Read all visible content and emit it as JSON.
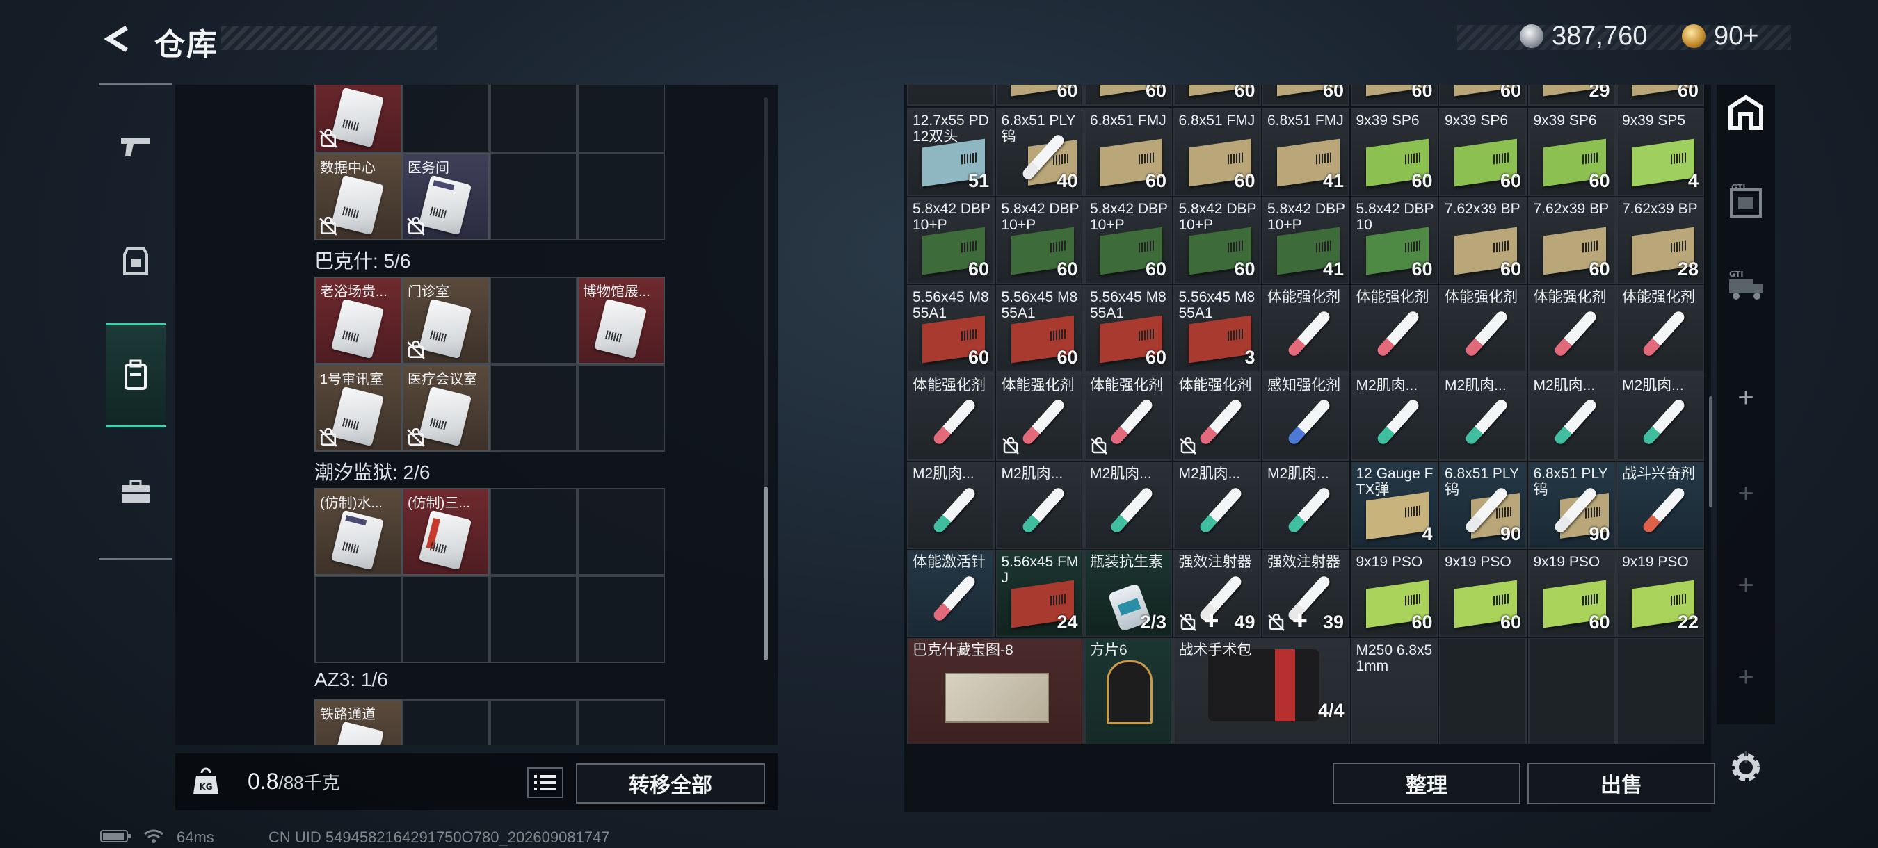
{
  "header": {
    "title": "仓库"
  },
  "currency": {
    "silver": "387,760",
    "gold": "90+"
  },
  "left_panel": {
    "sections": [
      {
        "name": "",
        "items": [
          {
            "label": "",
            "color": "red",
            "locked": true,
            "col": 0,
            "row": 0,
            "card": "plain"
          },
          {
            "label": "数据中心",
            "color": "brown",
            "locked": true,
            "col": 0,
            "row": 1,
            "card": "plain"
          },
          {
            "label": "医务间",
            "color": "purple",
            "locked": true,
            "col": 1,
            "row": 1,
            "card": "dark"
          }
        ]
      },
      {
        "name": "巴克什: 5/6",
        "items": [
          {
            "label": "老浴场贵...",
            "color": "red",
            "locked": false,
            "col": 0,
            "row": 0,
            "card": "plain"
          },
          {
            "label": "门诊室",
            "color": "brown",
            "locked": true,
            "col": 1,
            "row": 0,
            "card": "plain"
          },
          {
            "label": "博物馆展...",
            "color": "red",
            "locked": false,
            "col": 3,
            "row": 0,
            "card": "plain"
          },
          {
            "label": "1号审讯室",
            "color": "brown",
            "locked": true,
            "col": 0,
            "row": 1,
            "card": "plain"
          },
          {
            "label": "医疗会议室",
            "color": "brown",
            "locked": true,
            "col": 1,
            "row": 1,
            "card": "plain"
          }
        ]
      },
      {
        "name": "潮汐监狱: 2/6",
        "items": [
          {
            "label": "(仿制)水...",
            "color": "brown",
            "locked": false,
            "col": 0,
            "row": 0,
            "card": "dark"
          },
          {
            "label": "(仿制)三...",
            "color": "red",
            "locked": false,
            "col": 1,
            "row": 0,
            "card": "redstripe"
          }
        ]
      },
      {
        "name": "AZ3: 1/6",
        "items": [
          {
            "label": "铁路通道",
            "color": "brown",
            "locked": false,
            "col": 0,
            "row": 0,
            "card": "plain"
          }
        ]
      }
    ],
    "weight": {
      "current": "0.8",
      "max": "/88千克"
    },
    "transfer_all_label": "转移全部"
  },
  "inventory": {
    "top_row_counts": [
      "60",
      "60",
      "60",
      "60",
      "60",
      "60",
      "29",
      "60"
    ],
    "rows": [
      [
        {
          "label": "12.7x55 PD12双头",
          "count": "51",
          "kind": "ammo",
          "color": "#8fb7c2",
          "tone": "t-dark"
        },
        {
          "label": "6.8x51 PLY钨",
          "count": "40",
          "kind": "syringe-ammo",
          "color": "#e8eaec",
          "tone": "t-dark"
        },
        {
          "label": "6.8x51 FMJ",
          "count": "60",
          "kind": "ammo",
          "color": "#b9a77a",
          "tone": "t-dark"
        },
        {
          "label": "6.8x51 FMJ",
          "count": "60",
          "kind": "ammo",
          "color": "#b9a77a",
          "tone": "t-dark"
        },
        {
          "label": "6.8x51 FMJ",
          "count": "41",
          "kind": "ammo",
          "color": "#b9a77a",
          "tone": "t-dark"
        },
        {
          "label": "9x39 SP6",
          "count": "60",
          "kind": "ammo",
          "color": "#8cc152",
          "tone": "t-dark"
        },
        {
          "label": "9x39 SP6",
          "count": "60",
          "kind": "ammo",
          "color": "#8cc152",
          "tone": "t-dark"
        },
        {
          "label": "9x39 SP6",
          "count": "60",
          "kind": "ammo",
          "color": "#8cc152",
          "tone": "t-dark"
        },
        {
          "label": "9x39 SP5",
          "count": "4",
          "kind": "ammo",
          "color": "#9fcf5e",
          "tone": "t-dark"
        }
      ],
      [
        {
          "label": "5.8x42 DBP10+P",
          "count": "60",
          "kind": "ammo",
          "color": "#3d6b3a",
          "tone": "t-dark"
        },
        {
          "label": "5.8x42 DBP10+P",
          "count": "60",
          "kind": "ammo",
          "color": "#3d6b3a",
          "tone": "t-dark"
        },
        {
          "label": "5.8x42 DBP10+P",
          "count": "60",
          "kind": "ammo",
          "color": "#3d6b3a",
          "tone": "t-dark"
        },
        {
          "label": "5.8x42 DBP10+P",
          "count": "60",
          "kind": "ammo",
          "color": "#3d6b3a",
          "tone": "t-dark"
        },
        {
          "label": "5.8x42 DBP10+P",
          "count": "41",
          "kind": "ammo",
          "color": "#3d6b3a",
          "tone": "t-dark"
        },
        {
          "label": "5.8x42 DBP10",
          "count": "60",
          "kind": "ammo",
          "color": "#4f8a45",
          "tone": "t-dark"
        },
        {
          "label": "7.62x39 BP",
          "count": "60",
          "kind": "ammo",
          "color": "#b9a77a",
          "tone": "t-dark"
        },
        {
          "label": "7.62x39 BP",
          "count": "60",
          "kind": "ammo",
          "color": "#b9a77a",
          "tone": "t-dark"
        },
        {
          "label": "7.62x39 BP",
          "count": "28",
          "kind": "ammo",
          "color": "#b9a77a",
          "tone": "t-dark"
        }
      ],
      [
        {
          "label": "5.56x45 M855A1",
          "count": "60",
          "kind": "ammo",
          "color": "#a83a30",
          "tone": "t-dark"
        },
        {
          "label": "5.56x45 M855A1",
          "count": "60",
          "kind": "ammo",
          "color": "#a83a30",
          "tone": "t-dark"
        },
        {
          "label": "5.56x45 M855A1",
          "count": "60",
          "kind": "ammo",
          "color": "#a83a30",
          "tone": "t-dark"
        },
        {
          "label": "5.56x45 M855A1",
          "count": "3",
          "kind": "ammo",
          "color": "#a83a30",
          "tone": "t-dark"
        },
        {
          "label": "体能强化剂",
          "count": "",
          "kind": "syringe",
          "color": "#e36a7a",
          "tone": "t-dark"
        },
        {
          "label": "体能强化剂",
          "count": "",
          "kind": "syringe",
          "color": "#e36a7a",
          "tone": "t-dark"
        },
        {
          "label": "体能强化剂",
          "count": "",
          "kind": "syringe",
          "color": "#e36a7a",
          "tone": "t-dark"
        },
        {
          "label": "体能强化剂",
          "count": "",
          "kind": "syringe",
          "color": "#e36a7a",
          "tone": "t-dark"
        },
        {
          "label": "体能强化剂",
          "count": "",
          "kind": "syringe",
          "color": "#e36a7a",
          "tone": "t-dark"
        }
      ],
      [
        {
          "label": "体能强化剂",
          "count": "",
          "kind": "syringe",
          "color": "#e36a7a",
          "tone": "t-dark"
        },
        {
          "label": "体能强化剂",
          "count": "",
          "kind": "syringe",
          "color": "#e36a7a",
          "tone": "t-dark",
          "locked": true
        },
        {
          "label": "体能强化剂",
          "count": "",
          "kind": "syringe",
          "color": "#e36a7a",
          "tone": "t-dark",
          "locked": true
        },
        {
          "label": "体能强化剂",
          "count": "",
          "kind": "syringe",
          "color": "#e36a7a",
          "tone": "t-dark",
          "locked": true
        },
        {
          "label": "感知强化剂",
          "count": "",
          "kind": "syringe",
          "color": "#4c78d6",
          "tone": "t-dark"
        },
        {
          "label": "M2肌肉...",
          "count": "",
          "kind": "syringe",
          "color": "#3fbf9f",
          "tone": "t-dark"
        },
        {
          "label": "M2肌肉...",
          "count": "",
          "kind": "syringe",
          "color": "#3fbf9f",
          "tone": "t-dark"
        },
        {
          "label": "M2肌肉...",
          "count": "",
          "kind": "syringe",
          "color": "#3fbf9f",
          "tone": "t-dark"
        },
        {
          "label": "M2肌肉...",
          "count": "",
          "kind": "syringe",
          "color": "#3fbf9f",
          "tone": "t-dark"
        }
      ],
      [
        {
          "label": "M2肌肉...",
          "count": "",
          "kind": "syringe",
          "color": "#3fbf9f",
          "tone": "t-dark"
        },
        {
          "label": "M2肌肉...",
          "count": "",
          "kind": "syringe",
          "color": "#3fbf9f",
          "tone": "t-dark"
        },
        {
          "label": "M2肌肉...",
          "count": "",
          "kind": "syringe",
          "color": "#3fbf9f",
          "tone": "t-dark"
        },
        {
          "label": "M2肌肉...",
          "count": "",
          "kind": "syringe",
          "color": "#3fbf9f",
          "tone": "t-dark"
        },
        {
          "label": "M2肌肉...",
          "count": "",
          "kind": "syringe",
          "color": "#3fbf9f",
          "tone": "t-dark"
        },
        {
          "label": "12 Gauge FTX弹",
          "count": "4",
          "kind": "ammo",
          "color": "#c9b37d",
          "tone": "t-blue"
        },
        {
          "label": "6.8x51 PLY钨",
          "count": "90",
          "kind": "syringe-ammo",
          "color": "#e8eaec",
          "tone": "t-blue"
        },
        {
          "label": "6.8x51 PLY钨",
          "count": "90",
          "kind": "syringe-ammo",
          "color": "#e8eaec",
          "tone": "t-blue"
        },
        {
          "label": "战斗兴奋剂",
          "count": "",
          "kind": "syringe",
          "color": "#e0614a",
          "tone": "t-blue"
        }
      ],
      [
        {
          "label": "体能激活针",
          "count": "",
          "kind": "syringe",
          "color": "#e36a7a",
          "tone": "t-blue"
        },
        {
          "label": "5.56x45 FMJ",
          "count": "24",
          "kind": "ammo",
          "color": "#a83a30",
          "tone": "t-tealdark"
        },
        {
          "label": "瓶装抗生素",
          "count": "2/3",
          "kind": "bottle",
          "color": "#2a8fa6",
          "tone": "t-tealdark"
        },
        {
          "label": "强效注射器",
          "count": "49",
          "kind": "syringe",
          "color": "#e9e9e9",
          "tone": "t-dark",
          "locked": true,
          "plus": true
        },
        {
          "label": "强效注射器",
          "count": "39",
          "kind": "syringe",
          "color": "#e9e9e9",
          "tone": "t-dark",
          "locked": true,
          "plus": true
        },
        {
          "label": "9x19 PSO",
          "count": "60",
          "kind": "ammo",
          "color": "#a9d35a",
          "tone": "t-dark"
        },
        {
          "label": "9x19 PSO",
          "count": "60",
          "kind": "ammo",
          "color": "#a9d35a",
          "tone": "t-dark"
        },
        {
          "label": "9x19 PSO",
          "count": "60",
          "kind": "ammo",
          "color": "#a9d35a",
          "tone": "t-dark"
        },
        {
          "label": "9x19 PSO",
          "count": "22",
          "kind": "ammo",
          "color": "#a9d35a",
          "tone": "t-dark"
        }
      ]
    ],
    "large_items": [
      {
        "label": "巴克什藏宝图-8",
        "count": "",
        "kind": "map",
        "tone": "t-red",
        "col": 0,
        "span": 2
      },
      {
        "label": "方片6",
        "count": "",
        "kind": "card",
        "tone": "t-tealdark",
        "col": 2,
        "span": 1
      },
      {
        "label": "战术手术包",
        "count": "4/4",
        "kind": "medkit",
        "tone": "t-dark",
        "col": 3,
        "span": 2
      },
      {
        "label": "M250 6.8x51mm",
        "count": "",
        "kind": "belt",
        "tone": "t-dark",
        "col": 5,
        "span": 1
      }
    ],
    "sort_label": "整理",
    "sell_label": "出售"
  },
  "right_rail": {
    "slots": [
      "home-icon",
      "gti-box-icon",
      "gti-truck-icon",
      "+",
      "+",
      "+",
      "+",
      "+"
    ]
  },
  "status_bar": {
    "ping": "64ms",
    "uid": "CN UID 5494582164291750O780_202609081747"
  },
  "colors": {
    "accent": "#2fd9b0"
  }
}
